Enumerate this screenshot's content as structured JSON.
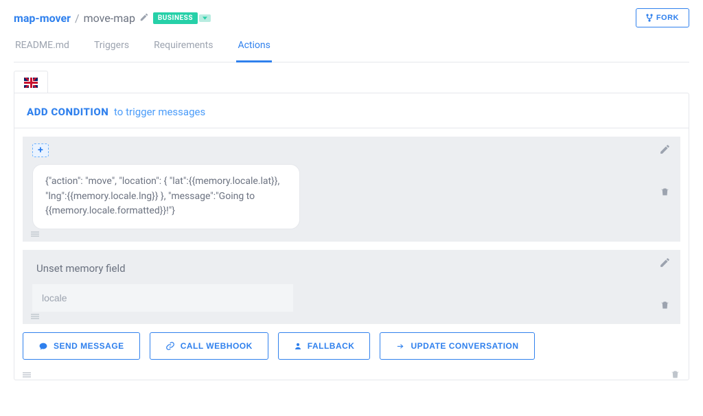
{
  "header": {
    "org": "map-mover",
    "project": "move-map",
    "badge_label": "BUSINESS",
    "fork_label": "FORK"
  },
  "tabs": {
    "items": [
      "README.md",
      "Triggers",
      "Requirements",
      "Actions"
    ],
    "active_index": 3
  },
  "lang_tab": {
    "icon": "flag-uk"
  },
  "condition_bar": {
    "add_label": "ADD CONDITION",
    "subtitle": "to trigger messages"
  },
  "blocks": {
    "b0": {
      "add_chip": "+",
      "bubble_text": "{\"action\": \"move\", \"location\": { \"lat\":{{memory.locale.lat}}, \"lng\":{{memory.locale.lng}}  }, \"message\":\"Going to {{memory.locale.formatted}}!\"}"
    },
    "b1": {
      "title": "Unset memory field",
      "input_value": "locale"
    }
  },
  "footer_buttons": {
    "send_message": "SEND MESSAGE",
    "call_webhook": "CALL WEBHOOK",
    "fallback": "FALLBACK",
    "update_conversation": "UPDATE CONVERSATION"
  }
}
